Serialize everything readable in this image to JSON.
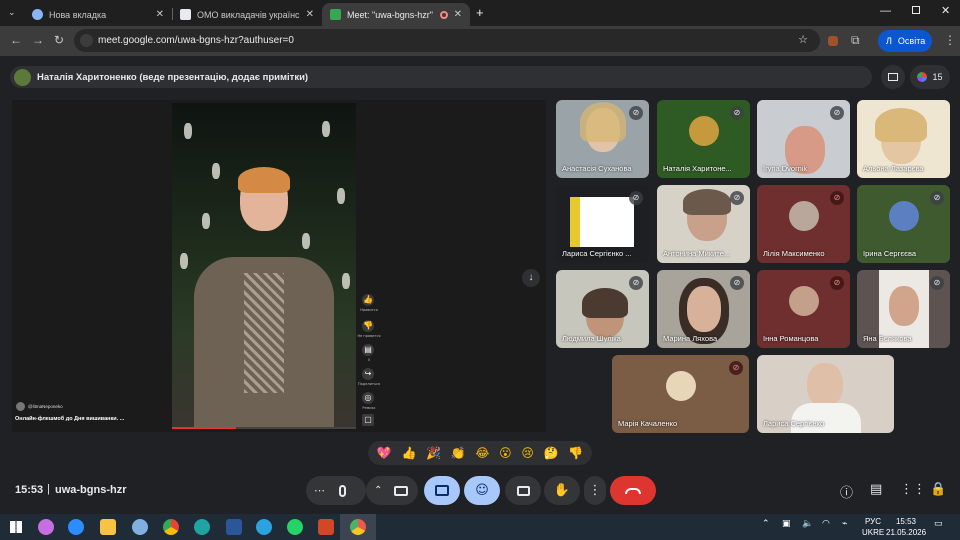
{
  "browser": {
    "tabs": [
      {
        "title": "Нова вкладка",
        "active": false
      },
      {
        "title": "ОМО викладачів української",
        "active": false
      },
      {
        "title": "Meet: \"uwa-bgns-hzr\"",
        "active": true
      }
    ],
    "url": "meet.google.com/uwa-bgns-hzr?authuser=0",
    "profile_initial": "Л",
    "profile_name": "Освіта"
  },
  "meet": {
    "presenter_banner": "Наталія Харитоненко (веде презентацію, додає примітки)",
    "participants_count": "15",
    "presentation": {
      "channel": "@litmaNeponeko",
      "caption": "Онлайн-флешмоб до Дня вишиванки. ...",
      "side_labels": [
        "Нравится",
        "Не нравится",
        "0",
        "Поделиться",
        "Ремикс"
      ]
    },
    "tiles": [
      {
        "name": "Анастасія Суханова",
        "muted": true
      },
      {
        "name": "Наталія Харитоне...",
        "muted": true
      },
      {
        "name": "Iryna Dvornik",
        "muted": true
      },
      {
        "name": "Альона Лазарєва",
        "muted": false
      },
      {
        "name": "Лариса Сергієнко ...",
        "muted": true
      },
      {
        "name": "Антонина Микитe...",
        "muted": true
      },
      {
        "name": "Лілія Максименко",
        "muted": true
      },
      {
        "name": "Ірина Сергєєва",
        "muted": true
      },
      {
        "name": "Людмила Шулiка",
        "muted": true
      },
      {
        "name": "Марина Ляхова",
        "muted": true
      },
      {
        "name": "Інна Романцова",
        "muted": true
      },
      {
        "name": "Яна Бєлякова",
        "muted": true
      },
      {
        "name": "Марія Качаленко",
        "muted": true
      },
      {
        "name": "Лариса Сергієнко",
        "muted": false
      }
    ],
    "reactions": [
      "💖",
      "👍",
      "🎉",
      "👏",
      "😂",
      "😮",
      "😢",
      "🤔",
      "👎"
    ],
    "time": "15:53",
    "separator": "|",
    "meeting_code": "uwa-bgns-hzr"
  },
  "taskbar": {
    "time": "15:53",
    "date": "21.05.2026",
    "lang_top": "РУС",
    "lang_bottom": "UKRE"
  },
  "colors": {
    "accent_blue": "#a8c7fa",
    "end_call_red": "#dc362e",
    "background": "#202124"
  }
}
